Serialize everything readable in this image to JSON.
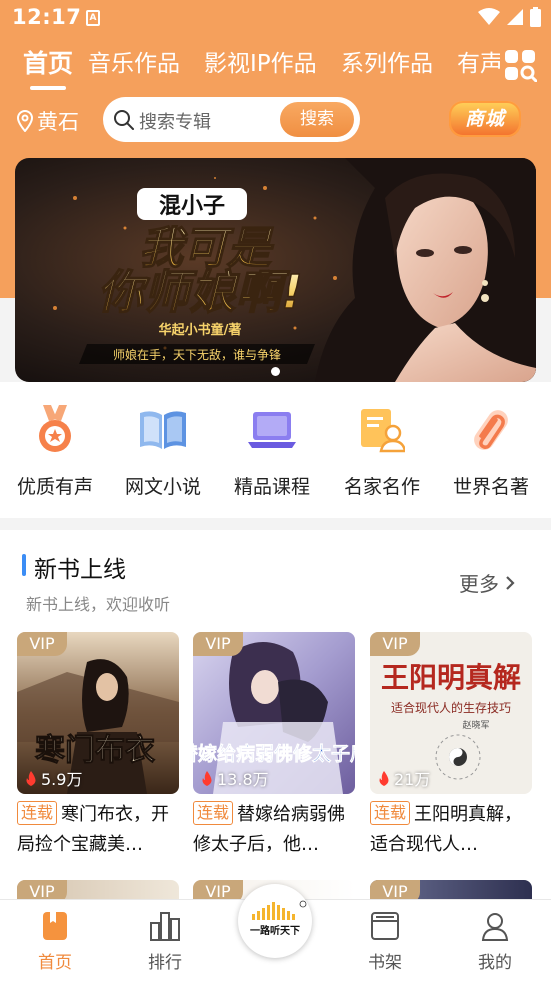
{
  "status": {
    "time": "12:17",
    "notif_glyph": "A"
  },
  "tabs": [
    {
      "label": "首页",
      "active": true
    },
    {
      "label": "音乐作品"
    },
    {
      "label": "影视IP作品"
    },
    {
      "label": "系列作品"
    },
    {
      "label": "有声"
    }
  ],
  "location": "黄石",
  "search": {
    "placeholder": "搜索专辑",
    "button": "搜索"
  },
  "shop_label": "商城",
  "banner": {
    "author_badge": "混小子",
    "title_line1": "我可是",
    "title_line2": "你师娘啊!",
    "author_line": "华起小书童/著",
    "slogan": "师娘在手，天下无敌，谁与争锋",
    "slide_count": 1,
    "active_slide": 0
  },
  "categories": [
    {
      "label": "优质有声",
      "icon": "medal-icon"
    },
    {
      "label": "网文小说",
      "icon": "open-book-icon"
    },
    {
      "label": "精品课程",
      "icon": "laptop-icon"
    },
    {
      "label": "名家名作",
      "icon": "writer-card-icon"
    },
    {
      "label": "世界名著",
      "icon": "paperclip-icon"
    }
  ],
  "section": {
    "title": "新书上线",
    "subtitle": "新书上线，欢迎收听",
    "more": "更多"
  },
  "books": [
    {
      "vip": "VIP",
      "plays": "5.9万",
      "tag": "连载",
      "title": "寒门布衣，开局捡个宝藏美…",
      "cover_text": "寒门布衣"
    },
    {
      "vip": "VIP",
      "plays": "13.8万",
      "tag": "连载",
      "title": "替嫁给病弱佛修太子后，他…",
      "cover_text": "替嫁给病弱佛修太子后"
    },
    {
      "vip": "VIP",
      "plays": "21万",
      "tag": "连载",
      "title": "王阳明真解，适合现代人…",
      "cover_text": "王阳明真解",
      "cover_sub": "适合现代人的生存技巧",
      "cover_author": "赵晓军"
    }
  ],
  "row2_vip": [
    "VIP",
    "VIP",
    "VIP"
  ],
  "nav": [
    {
      "label": "首页",
      "active": true
    },
    {
      "label": "排行"
    },
    {
      "label": "书架"
    },
    {
      "label": "我的"
    }
  ],
  "center_logo_text": "一路听天下",
  "colors": {
    "brand": "#f5a05c",
    "accent": "#f08a3d",
    "vip": "#c9a77a",
    "section_bar": "#3b8df5"
  }
}
